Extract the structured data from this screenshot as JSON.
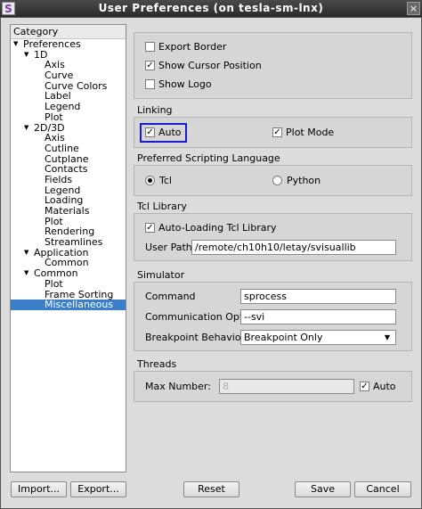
{
  "window": {
    "title": "User Preferences (on tesla-sm-lnx)",
    "app_icon": "S",
    "close_icon": "×"
  },
  "tree": {
    "header": "Category",
    "items": [
      {
        "label": "Preferences",
        "level": 0,
        "expanded": true
      },
      {
        "label": "1D",
        "level": 1,
        "expanded": true
      },
      {
        "label": "Axis",
        "level": 2
      },
      {
        "label": "Curve",
        "level": 2
      },
      {
        "label": "Curve Colors",
        "level": 2
      },
      {
        "label": "Label",
        "level": 2
      },
      {
        "label": "Legend",
        "level": 2
      },
      {
        "label": "Plot",
        "level": 2
      },
      {
        "label": "2D/3D",
        "level": 1,
        "expanded": true
      },
      {
        "label": "Axis",
        "level": 2
      },
      {
        "label": "Cutline",
        "level": 2
      },
      {
        "label": "Cutplane",
        "level": 2
      },
      {
        "label": "Contacts",
        "level": 2
      },
      {
        "label": "Fields",
        "level": 2
      },
      {
        "label": "Legend",
        "level": 2
      },
      {
        "label": "Loading",
        "level": 2
      },
      {
        "label": "Materials",
        "level": 2
      },
      {
        "label": "Plot",
        "level": 2
      },
      {
        "label": "Rendering",
        "level": 2
      },
      {
        "label": "Streamlines",
        "level": 2
      },
      {
        "label": "Application",
        "level": 1,
        "expanded": true
      },
      {
        "label": "Common",
        "level": 2
      },
      {
        "label": "Common",
        "level": 1,
        "expanded": true
      },
      {
        "label": "Plot",
        "level": 2
      },
      {
        "label": "Frame Sorting",
        "level": 2
      },
      {
        "label": "Miscellaneous",
        "level": 2,
        "selected": true
      }
    ]
  },
  "general": {
    "export_border": {
      "label": "Export Border",
      "checked": false
    },
    "show_cursor_position": {
      "label": "Show Cursor Position",
      "checked": true
    },
    "show_logo": {
      "label": "Show Logo",
      "checked": false
    }
  },
  "linking": {
    "title": "Linking",
    "auto": {
      "label": "Auto",
      "checked": true
    },
    "plot_mode": {
      "label": "Plot Mode",
      "checked": true
    }
  },
  "scripting": {
    "title": "Preferred Scripting Language",
    "tcl": {
      "label": "Tcl",
      "selected": true
    },
    "python": {
      "label": "Python",
      "selected": false
    }
  },
  "tcl_library": {
    "title": "Tcl Library",
    "auto_loading": {
      "label": "Auto-Loading Tcl Library",
      "checked": true
    },
    "user_path_label": "User Path:",
    "user_path_value": "/remote/ch10h10/letay/svisuallib"
  },
  "simulator": {
    "title": "Simulator",
    "command_label": "Command",
    "command_value": "sprocess",
    "comm_option_label": "Communication Option",
    "comm_option_value": "--svi",
    "breakpoint_label": "Breakpoint Behavior",
    "breakpoint_value": "Breakpoint Only"
  },
  "threads": {
    "title": "Threads",
    "max_number_label": "Max Number:",
    "max_number_value": "8",
    "auto": {
      "label": "Auto",
      "checked": true
    }
  },
  "buttons": {
    "import": "Import...",
    "export": "Export...",
    "reset": "Reset",
    "save": "Save",
    "cancel": "Cancel"
  },
  "colors": {
    "selection": "#3a7fc8",
    "highlight_border": "#1a1ad0"
  },
  "check_glyph": "✓"
}
